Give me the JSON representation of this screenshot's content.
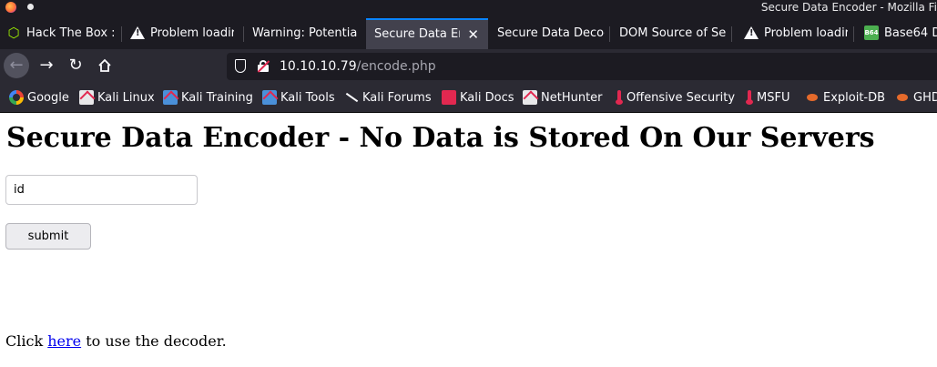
{
  "window": {
    "title": "Secure Data Encoder - Mozilla Fi"
  },
  "tabs": [
    {
      "label": "Hack The Box :",
      "icon": "hackthebox-icon",
      "active": false
    },
    {
      "label": "Problem loadir",
      "icon": "warning-icon",
      "active": false
    },
    {
      "label": "Warning: Potentia",
      "icon": "",
      "active": false
    },
    {
      "label": "Secure Data En",
      "icon": "",
      "active": true
    },
    {
      "label": "Secure Data Decoc",
      "icon": "",
      "active": false
    },
    {
      "label": "DOM Source of Se",
      "icon": "",
      "active": false
    },
    {
      "label": "Problem loadir",
      "icon": "warning-icon",
      "active": false
    },
    {
      "label": "Base64 D",
      "icon": "base64-icon",
      "active": false
    }
  ],
  "tab_icon_text": {
    "base64": "B64",
    "hackthebox": "⬡"
  },
  "navigation": {
    "url_host": "10.10.10.79",
    "url_path": "/encode.php"
  },
  "bookmarks": [
    {
      "label": "Google",
      "icon": "google-icon"
    },
    {
      "label": "Kali Linux",
      "icon": "kali-icon"
    },
    {
      "label": "Kali Training",
      "icon": "kali-training-icon"
    },
    {
      "label": "Kali Tools",
      "icon": "kali-tools-icon"
    },
    {
      "label": "Kali Forums",
      "icon": "kali-dragon-icon"
    },
    {
      "label": "Kali Docs",
      "icon": "kali-docs-icon"
    },
    {
      "label": "NetHunter",
      "icon": "nethunter-icon"
    },
    {
      "label": "Offensive Security",
      "icon": "offsec-icon"
    },
    {
      "label": "MSFU",
      "icon": "msfu-icon"
    },
    {
      "label": "Exploit-DB",
      "icon": "exploitdb-icon"
    },
    {
      "label": "GHD",
      "icon": "ghdb-icon"
    }
  ],
  "page": {
    "heading": "Secure Data Encoder - No Data is Stored On Our Servers",
    "input_value": "id",
    "submit_label": "submit",
    "footer_before": "Click ",
    "footer_link": "here",
    "footer_after": " to use the decoder."
  },
  "colors": {
    "chrome_dark": "#1c1b22",
    "toolbar": "#2b2a33",
    "active_tab": "#42414d",
    "accent": "#0a84ff",
    "link": "#0000ee"
  }
}
